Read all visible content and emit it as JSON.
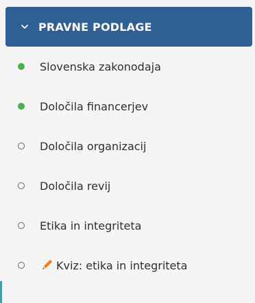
{
  "section": {
    "title": "PRAVNE PODLAGE",
    "chevron_icon": "chevron-down-icon",
    "bg_color": "#2f5f95"
  },
  "items": [
    {
      "label": "Slovenska zakonodaja",
      "status": "completed"
    },
    {
      "label": "Določila financerjev",
      "status": "completed"
    },
    {
      "label": "Določila organizacij",
      "status": "not-started"
    },
    {
      "label": "Določila revij",
      "status": "not-started"
    },
    {
      "label": "Etika in integriteta",
      "status": "not-started"
    },
    {
      "label": "Kviz: etika in integriteta",
      "status": "not-started",
      "icon": "pencil-icon"
    }
  ],
  "colors": {
    "completed": "#4caf50",
    "pencil": "#f47c20"
  }
}
